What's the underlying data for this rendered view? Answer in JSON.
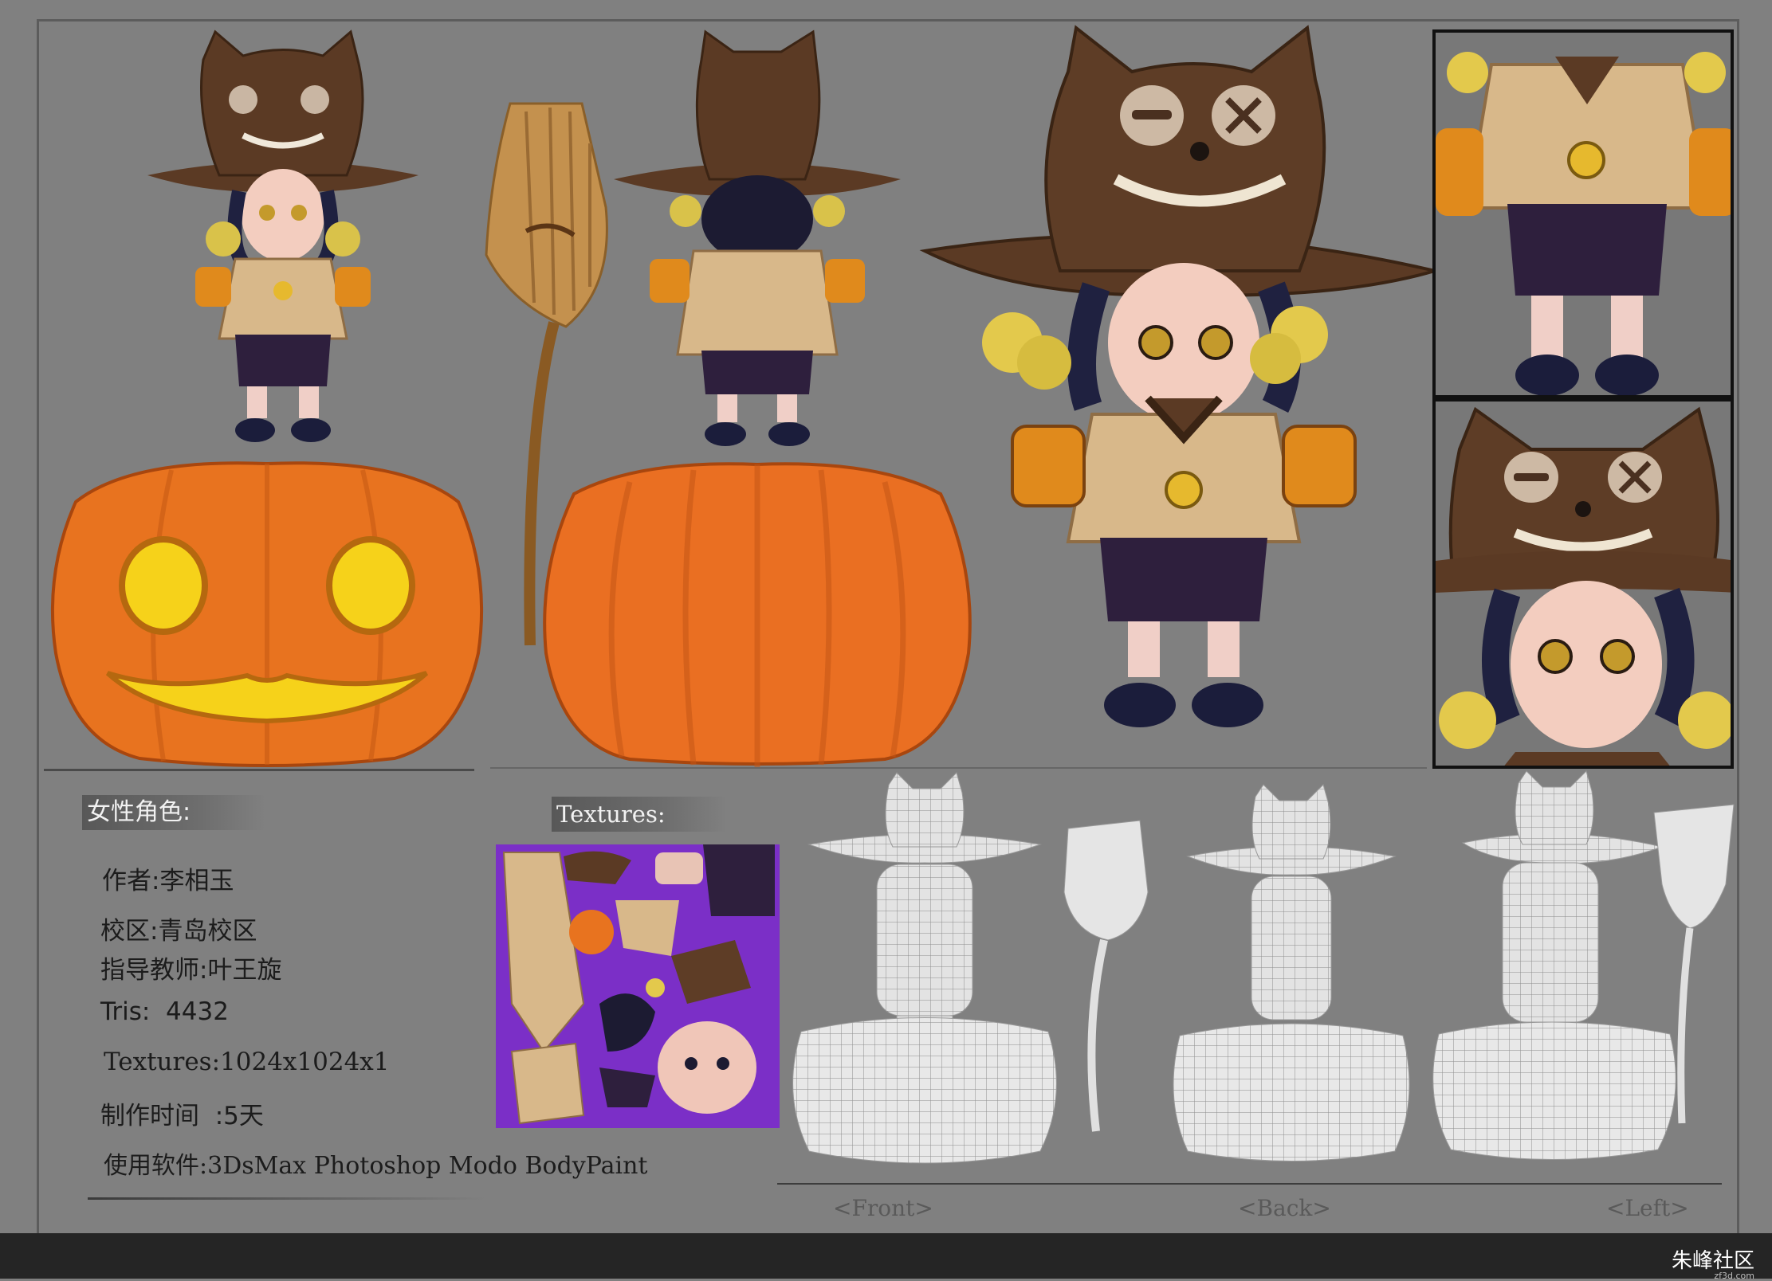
{
  "header": {
    "role_label": "女性角色:",
    "textures_label": "Textures:"
  },
  "info": {
    "author": "作者:李相玉",
    "campus": "校区:青岛校区",
    "teacher": "指导教师:叶王旋",
    "tris": "Tris:  4432",
    "textures": "Textures:1024x1024x1",
    "time": "制作时间  :5天",
    "software": "使用软件:3DsMax Photoshop Modo BodyPaint"
  },
  "wireframe_labels": {
    "front": "<Front>",
    "back": "<Back>",
    "left": "<Left>"
  },
  "watermark": {
    "text": "朱峰社区",
    "url": "zf3d.com"
  },
  "colors": {
    "background": "#808080",
    "pumpkin": "#e8731f",
    "pumpkin_glow": "#f6d21a",
    "hat": "#5b3a24",
    "coat": "#d8b88a",
    "shorts": "#2e1f3d",
    "texture_bg": "#7b2fc7"
  }
}
